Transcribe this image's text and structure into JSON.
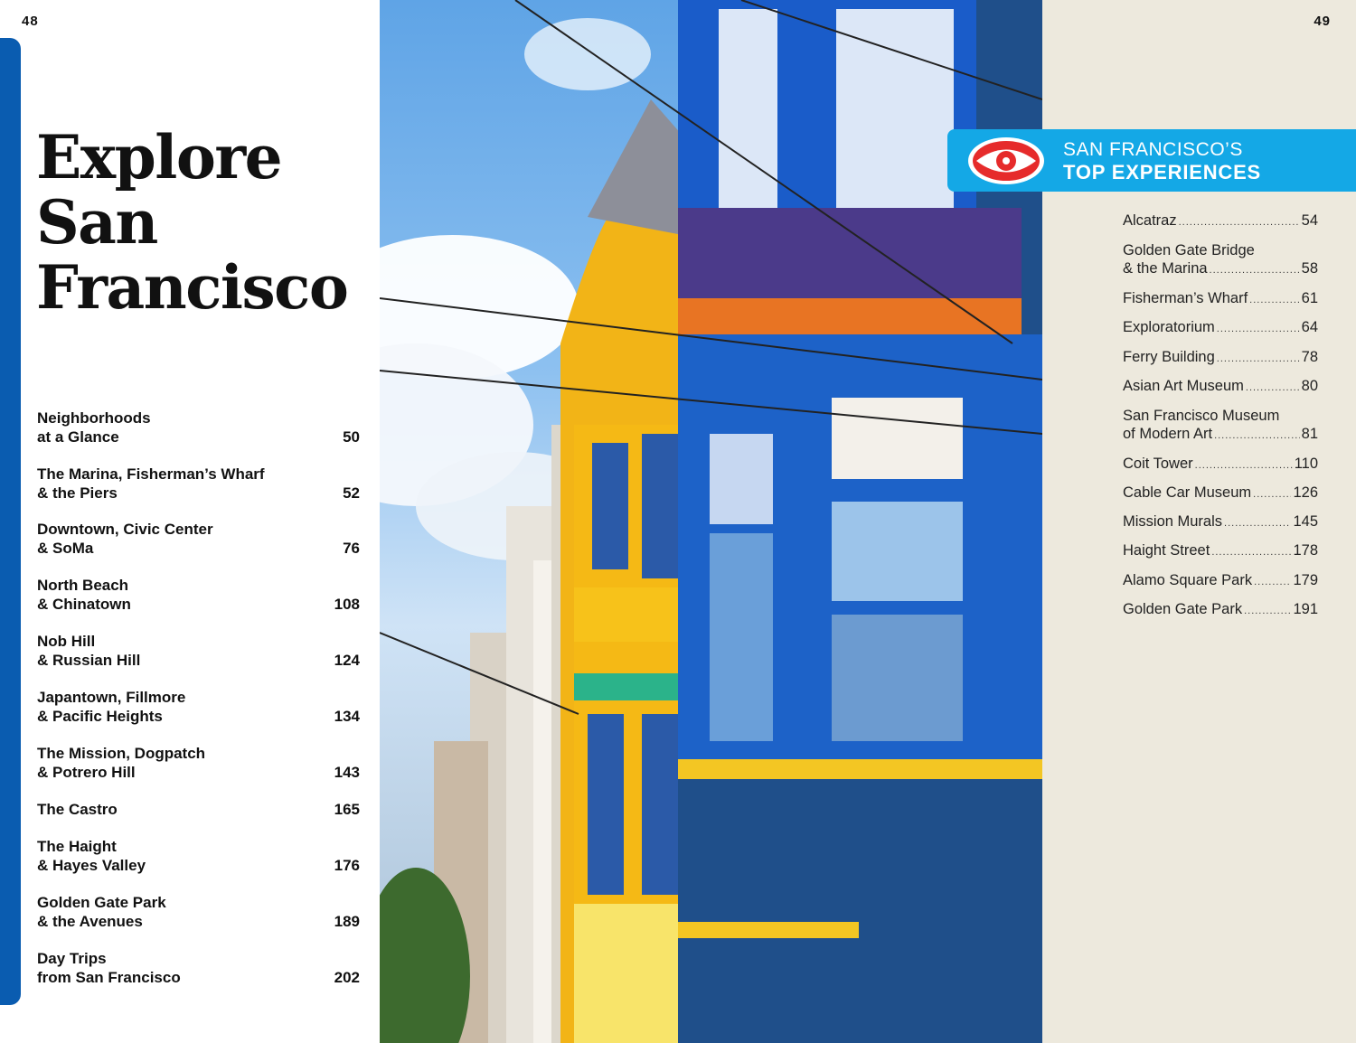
{
  "page_numbers": {
    "left": "48",
    "right": "49"
  },
  "title": {
    "line1": "Explore",
    "line2": "San",
    "line3": "Francisco"
  },
  "neighborhoods": [
    {
      "line1": "Neighborhoods",
      "line2": "at a Glance",
      "page": "50"
    },
    {
      "line1": "The Marina, Fisherman’s Wharf",
      "line2": "& the Piers",
      "page": "52"
    },
    {
      "line1": "Downtown, Civic Center",
      "line2": "& SoMa",
      "page": "76"
    },
    {
      "line1": "North Beach",
      "line2": "& Chinatown",
      "page": "108"
    },
    {
      "line1": "Nob Hill",
      "line2": "& Russian Hill",
      "page": "124"
    },
    {
      "line1": "Japantown, Fillmore",
      "line2": "& Pacific Heights",
      "page": "134"
    },
    {
      "line1": "The Mission, Dogpatch",
      "line2": "& Potrero Hill",
      "page": "143"
    },
    {
      "line1": "The Castro",
      "line2": "",
      "page": "165"
    },
    {
      "line1": "The Haight",
      "line2": "& Hayes Valley",
      "page": "176"
    },
    {
      "line1": "Golden Gate Park",
      "line2": "& the Avenues",
      "page": "189"
    },
    {
      "line1": "Day Trips",
      "line2": "from San Francisco",
      "page": "202"
    }
  ],
  "banner": {
    "line1": "SAN FRANCISCO’S",
    "line2": "TOP EXPERIENCES",
    "icon": "eye-icon"
  },
  "top_experiences": [
    {
      "line1": "",
      "name": "Alcatraz",
      "page": "54"
    },
    {
      "line1": "Golden Gate Bridge",
      "name": "& the Marina",
      "page": "58"
    },
    {
      "line1": "",
      "name": "Fisherman’s Wharf",
      "page": "61"
    },
    {
      "line1": "",
      "name": "Exploratorium",
      "page": "64"
    },
    {
      "line1": "",
      "name": "Ferry Building",
      "page": "78"
    },
    {
      "line1": "",
      "name": "Asian Art Museum",
      "page": "80"
    },
    {
      "line1": "San Francisco Museum",
      "name": "of Modern Art",
      "page": "81"
    },
    {
      "line1": "",
      "name": "Coit Tower",
      "page": "110"
    },
    {
      "line1": "",
      "name": "Cable Car Museum",
      "page": "126"
    },
    {
      "line1": "",
      "name": "Mission Murals",
      "page": "145"
    },
    {
      "line1": "",
      "name": "Haight Street",
      "page": "178"
    },
    {
      "line1": "",
      "name": "Alamo Square Park",
      "page": "179"
    },
    {
      "line1": "",
      "name": "Golden Gate Park",
      "page": "191"
    }
  ],
  "colors": {
    "tab_blue": "#0a5cb0",
    "banner_blue": "#14a8e6",
    "eye_red": "#e62b2b",
    "right_bg": "#ede9dd"
  }
}
